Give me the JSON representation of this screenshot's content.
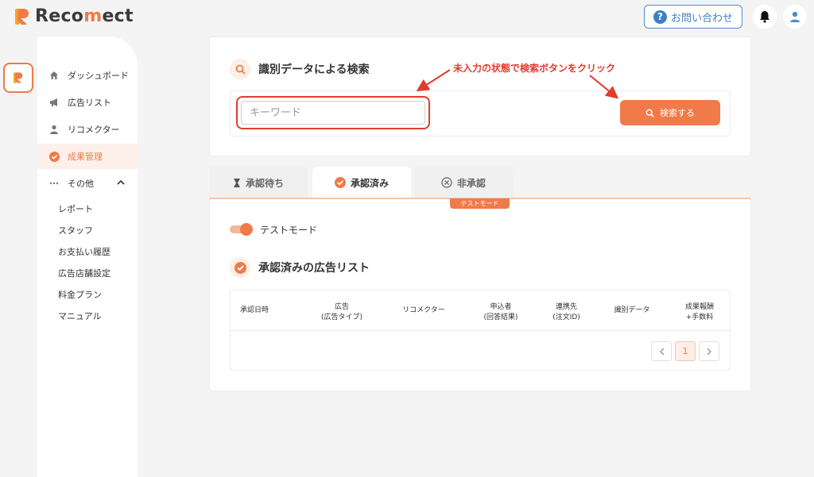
{
  "header": {
    "brand_prefix": "Reco",
    "brand_accent": "m",
    "brand_suffix": "ect",
    "contact_label": "お問い合わせ"
  },
  "sidebar": {
    "items": [
      {
        "label": "ダッシュボード",
        "icon": "home-icon"
      },
      {
        "label": "広告リスト",
        "icon": "megaphone-icon"
      },
      {
        "label": "リコメクター",
        "icon": "person-icon"
      },
      {
        "label": "成果管理",
        "icon": "check-circle-icon",
        "active": true
      },
      {
        "label": "その他",
        "icon": "more-icon"
      }
    ],
    "sub_items": [
      "レポート",
      "スタッフ",
      "お支払い履歴",
      "広告店舗設定",
      "料金プラン",
      "マニュアル"
    ]
  },
  "search": {
    "title": "識別データによる検索",
    "placeholder": "キーワード",
    "button_label": "検索する",
    "annotation": "未入力の状態で検索ボタンをクリック"
  },
  "tabs": [
    {
      "label": "承認待ち",
      "icon": "hourglass-icon"
    },
    {
      "label": "承認済み",
      "icon": "check-circle-icon",
      "active": true
    },
    {
      "label": "非承認",
      "icon": "x-circle-icon"
    }
  ],
  "test_badge": "テストモード",
  "toggle_label": "テストモード",
  "list": {
    "title": "承認済みの広告リスト",
    "columns": [
      {
        "line1": "承認日時",
        "line2": ""
      },
      {
        "line1": "広告",
        "line2": "(広告タイプ)"
      },
      {
        "line1": "リコメクター",
        "line2": ""
      },
      {
        "line1": "申込者",
        "line2": "(回答結果)"
      },
      {
        "line1": "連携先",
        "line2": "(注文ID)"
      },
      {
        "line1": "識別データ",
        "line2": ""
      },
      {
        "line1": "成果報酬",
        "line2": "+手数料"
      }
    ],
    "pagination": {
      "current": "1"
    }
  },
  "colors": {
    "accent": "#f07a4a",
    "annotation": "#e33b2e",
    "link": "#3f7fc4"
  }
}
